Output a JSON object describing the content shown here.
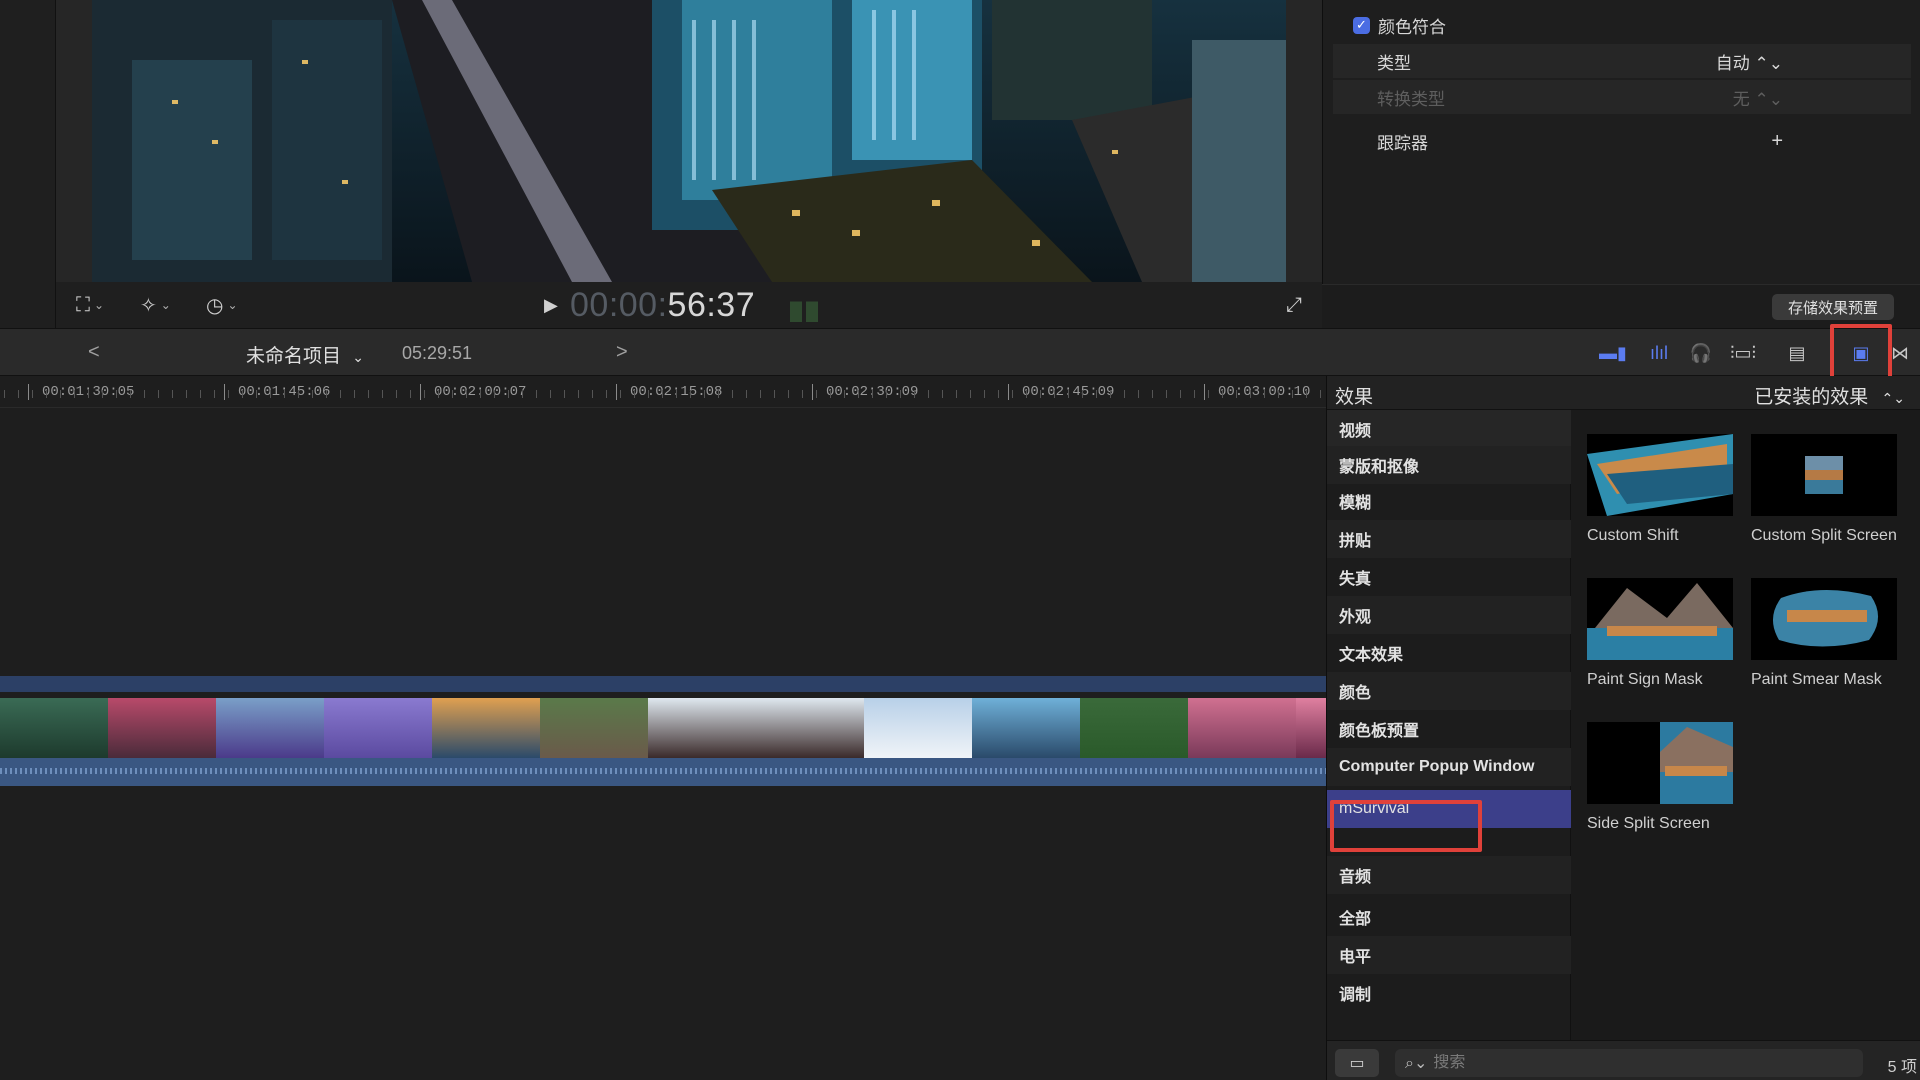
{
  "viewer": {
    "timecode_dim": "00:00:",
    "timecode_bright": "56:37"
  },
  "inspector": {
    "color_conform_label": "颜色符合",
    "type_label": "类型",
    "type_value": "自动 ⌃⌄",
    "transform_type_label": "转换类型",
    "transform_type_value": "无 ⌃⌄",
    "tracker_label": "跟踪器",
    "tracker_add": "+",
    "save_preset_label": "存储效果预置"
  },
  "timeline_bar": {
    "back": "<",
    "forward": ">",
    "project_name": "未命名项目",
    "project_duration": "05:29:51"
  },
  "ruler": {
    "labels": [
      "00:01:30:05",
      "00:01:45:06",
      "00:02:00:07",
      "00:02:15:08",
      "00:02:30:09",
      "00:02:45:09",
      "00:03:00:10"
    ]
  },
  "effects": {
    "title": "效果",
    "installed_label": "已安装的效果",
    "categories": [
      "视频",
      "蒙版和抠像",
      "模糊",
      "拼贴",
      "失真",
      "外观",
      "文本效果",
      "颜色",
      "颜色板预置",
      "Computer Popup Window",
      "mSurvival",
      "音频",
      "全部",
      "电平",
      "调制"
    ],
    "items": [
      {
        "name": "Custom Shift"
      },
      {
        "name": "Custom Split Screen"
      },
      {
        "name": "Paint Sign Mask"
      },
      {
        "name": "Paint Smear Mask"
      },
      {
        "name": "Side Split Screen"
      }
    ],
    "search_placeholder": "搜索",
    "count": "5 项"
  },
  "colors": {
    "accent": "#4b6de3",
    "selection": "#3c3f8a",
    "highlight_box": "#e0413a"
  }
}
